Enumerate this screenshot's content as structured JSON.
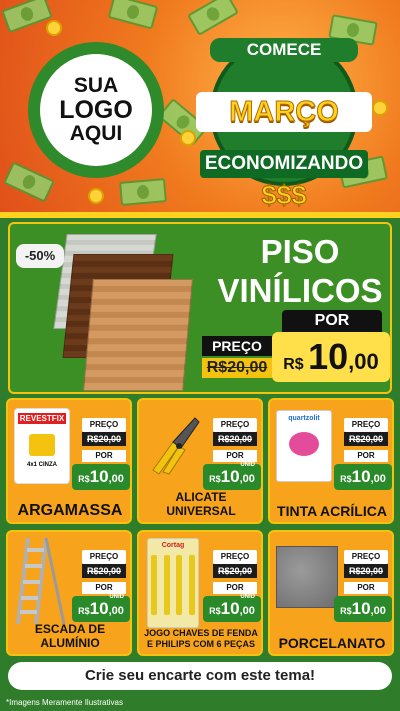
{
  "hero": {
    "logo": {
      "line1": "SUA",
      "line2": "LOGO",
      "line3": "AQUI"
    },
    "badge": {
      "top": "COMECE",
      "middle": "MARÇO",
      "bottom": "ECONOMIZANDO",
      "symbol": "$$$"
    }
  },
  "featured": {
    "discount": "-50%",
    "title_line1": "PISO",
    "title_line2": "VINÍLICOS",
    "por_label": "POR",
    "preco_label": "PREÇO",
    "old_price": "R$20,00",
    "currency": "R$",
    "new_int": "10",
    "new_dec": ",00"
  },
  "products": [
    {
      "name": "ARGAMASSA",
      "preco": "PREÇO",
      "old": "R$20,00",
      "por": "POR",
      "cur": "R$",
      "int": "10",
      "dec": ",00",
      "unid": ""
    },
    {
      "name": "ALICATE UNIVERSAL",
      "preco": "PREÇO",
      "old": "R$20,00",
      "por": "POR",
      "cur": "R$",
      "int": "10",
      "dec": ",00",
      "unid": "UNID"
    },
    {
      "name": "TINTA ACRÍLICA",
      "preco": "PREÇO",
      "old": "R$20,00",
      "por": "POR",
      "cur": "R$",
      "int": "10",
      "dec": ",00",
      "unid": ""
    },
    {
      "name": "ESCADA DE ALUMÍNIO",
      "preco": "PREÇO",
      "old": "R$20,00",
      "por": "POR",
      "cur": "R$",
      "int": "10",
      "dec": ",00",
      "unid": "UNID"
    },
    {
      "name": "JOGO CHAVES DE FENDA E PHILIPS COM 6 PEÇAS",
      "preco": "PREÇO",
      "old": "R$20,00",
      "por": "POR",
      "cur": "R$",
      "int": "10",
      "dec": ",00",
      "unid": "UNID"
    },
    {
      "name": "PORCELANATO",
      "preco": "PREÇO",
      "old": "R$20,00",
      "por": "POR",
      "cur": "R$",
      "int": "10",
      "dec": ",00",
      "unid": ""
    }
  ],
  "product_images": {
    "argamassa_brand": "REVESTFIX",
    "argamassa_sub": "4x1 CINZA",
    "tinta_brand": "quartzolit",
    "chaves_brand": "Cortag"
  },
  "footer": {
    "cta": "Crie seu encarte com este tema!",
    "disclaimer": "*Imagens Meramente Ilustrativas"
  },
  "colors": {
    "green": "#2f7d2a",
    "orange": "#f7a41c",
    "yellow": "#f4c30f",
    "price_green": "#2a8a2a"
  }
}
